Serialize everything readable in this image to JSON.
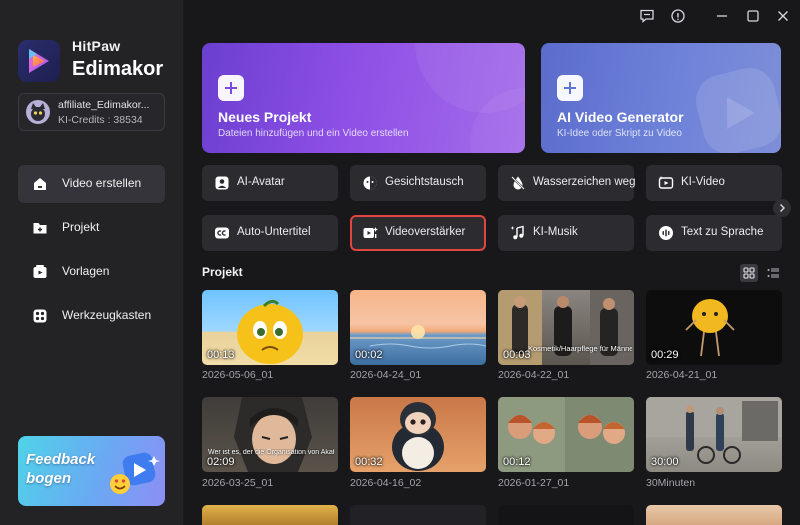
{
  "window": {
    "controls": [
      "feedback-icon",
      "info-icon",
      "minimize-icon",
      "maximize-icon",
      "close-icon"
    ]
  },
  "brand": {
    "top": "HitPaw",
    "main": "Edimakor"
  },
  "account": {
    "name": "affiliate_Edimakor...",
    "credits": "KI-Credits : 38534"
  },
  "sidebar": {
    "items": [
      {
        "label": "Video erstellen",
        "icon": "home-icon",
        "active": true
      },
      {
        "label": "Projekt",
        "icon": "folder-icon",
        "active": false
      },
      {
        "label": "Vorlagen",
        "icon": "template-icon",
        "active": false
      },
      {
        "label": "Werkzeugkasten",
        "icon": "toolbox-icon",
        "active": false
      }
    ],
    "feedback": {
      "line1": "Feedback",
      "line2": "bogen"
    }
  },
  "cards": {
    "new_project": {
      "title": "Neues Projekt",
      "subtitle": "Dateien hinzufügen und ein Video erstellen"
    },
    "ai_video": {
      "title": "AI Video Generator",
      "subtitle": "KI-Idee oder Skript zu Video"
    }
  },
  "tools": [
    {
      "label": "AI-Avatar",
      "icon": "avatar-icon"
    },
    {
      "label": "Gesichtstausch",
      "icon": "face-swap-icon"
    },
    {
      "label": "Wasserzeichen weg",
      "icon": "watermark-remove-icon"
    },
    {
      "label": "KI-Video",
      "icon": "ai-video-icon"
    },
    {
      "label": "Auto-Untertitel",
      "icon": "subtitle-icon"
    },
    {
      "label": "Videoverstärker",
      "icon": "video-enhancer-icon"
    },
    {
      "label": "KI-Musik",
      "icon": "music-icon"
    },
    {
      "label": "Text zu Sprache",
      "icon": "text-to-speech-icon"
    }
  ],
  "projects": {
    "title": "Projekt",
    "items": [
      {
        "name": "2026-05-06_01",
        "duration": "00:13"
      },
      {
        "name": "2026-04-24_01",
        "duration": "00:02"
      },
      {
        "name": "2026-04-22_01",
        "duration": "00:03",
        "overlay": "Kosmetik/Haarpflege für Männer/Frauen"
      },
      {
        "name": "2026-04-21_01",
        "duration": "00:29"
      },
      {
        "name": "2026-03-25_01",
        "duration": "02:09",
        "overlay": "Wer ist es, der die Organisation von Akatsuki anleitet?"
      },
      {
        "name": "2026-04-16_02",
        "duration": "00:32"
      },
      {
        "name": "2026-01-27_01",
        "duration": "00:12"
      },
      {
        "name": "30Minuten",
        "duration": "30:00"
      }
    ]
  },
  "colors": {
    "accent_red": "#e0463f",
    "card_purple": "#8e4fe6",
    "card_blue": "#6e82d9",
    "bg": "#18181b",
    "sidebar_bg": "#232326"
  }
}
